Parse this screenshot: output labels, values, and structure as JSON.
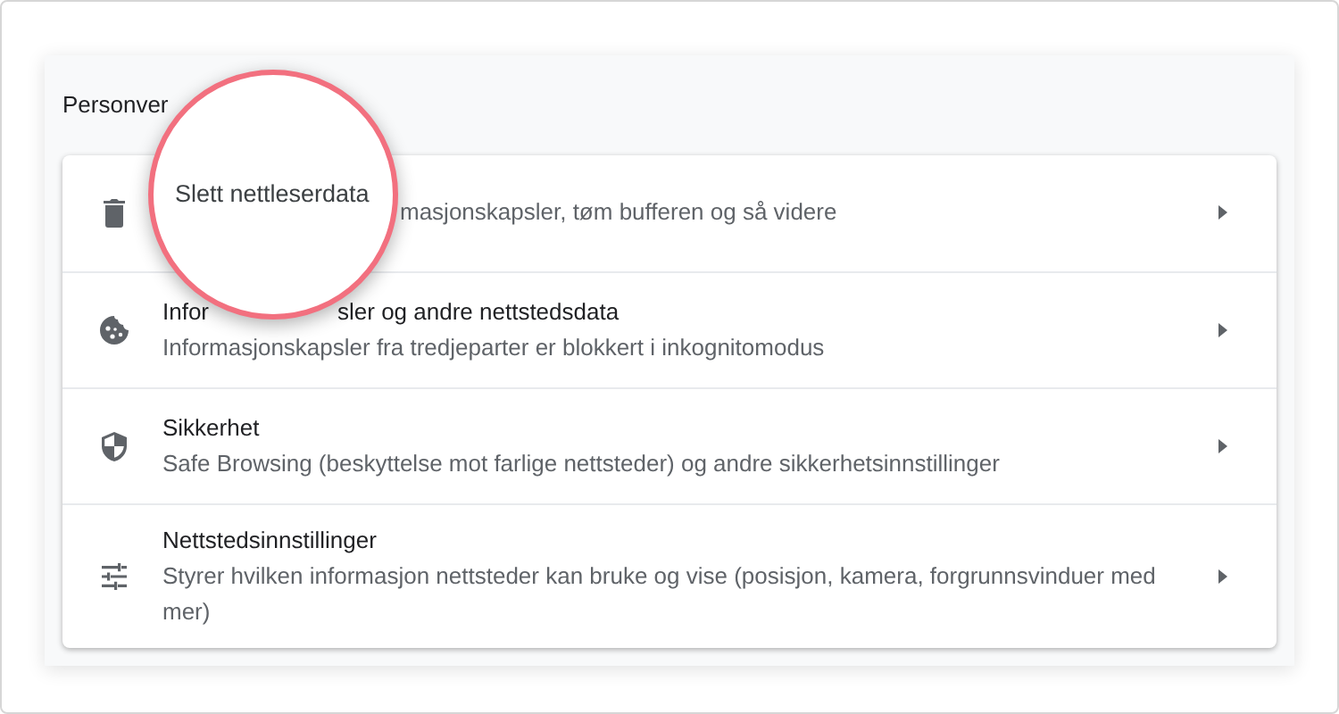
{
  "section": {
    "heading": "Personver"
  },
  "rows": [
    {
      "kind": "trash",
      "subtitle_tail": "masjonskapsler, tøm bufferen og så videre"
    },
    {
      "kind": "cookie",
      "title_head": "Infor",
      "title_tail": "sler og andre nettstedsdata",
      "subtitle": "Informasjonskapsler fra tredjeparter er blokkert i inkognitomodus"
    },
    {
      "kind": "shield",
      "title": "Sikkerhet",
      "subtitle": "Safe Browsing (beskyttelse mot farlige nettsteder) og andre sikkerhetsinnstillinger"
    },
    {
      "kind": "sliders",
      "title": "Nettstedsinnstillinger",
      "subtitle": "Styrer hvilken informasjon nettsteder kan bruke og vise (posisjon, kamera, forgrunnsvinduer med mer)"
    }
  ],
  "magnifier": {
    "text": "Slett nettleserdata"
  }
}
